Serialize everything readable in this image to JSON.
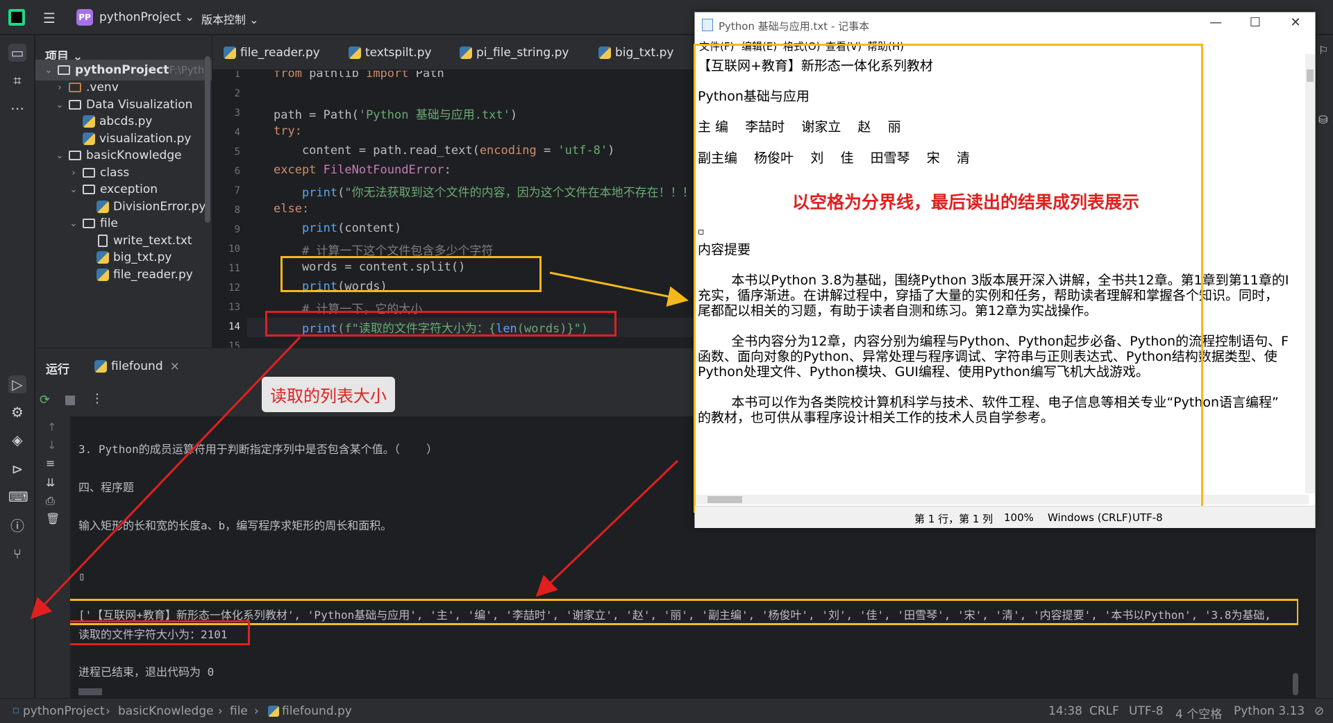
{
  "titlebar": {
    "project_badge": "PP",
    "project": "pythonProject ⌄",
    "vcs": "版本控制 ⌄"
  },
  "project_panel": {
    "header": "项目 ⌄",
    "tree": [
      {
        "label": "pythonProject",
        "extra": " F:\\Pytho",
        "type": "folder",
        "open": true
      },
      {
        "label": ".venv",
        "type": "folder",
        "open": false
      },
      {
        "label": "Data Visualization",
        "type": "folder",
        "open": true
      },
      {
        "label": "abcds.py",
        "type": "py"
      },
      {
        "label": "visualization.py",
        "type": "py"
      },
      {
        "label": "basicKnowledge",
        "type": "folder",
        "open": true
      },
      {
        "label": "class",
        "type": "folder",
        "open": false
      },
      {
        "label": "exception",
        "type": "folder",
        "open": true
      },
      {
        "label": "DivisionError.py",
        "type": "py"
      },
      {
        "label": "file",
        "type": "folder",
        "open": true
      },
      {
        "label": "write_text.txt",
        "type": "txt"
      },
      {
        "label": "big_txt.py",
        "type": "py"
      },
      {
        "label": "file_reader.py",
        "type": "py"
      }
    ]
  },
  "tabs": [
    "file_reader.py",
    "textspilt.py",
    "pi_file_string.py",
    "big_txt.py"
  ],
  "editor": {
    "line_numbers": [
      "1",
      "2",
      "3",
      "4",
      "5",
      "6",
      "7",
      "8",
      "9",
      "10",
      "11",
      "12",
      "13",
      "14",
      "15"
    ],
    "l1_a": "from",
    "l1_b": " pathlib ",
    "l1_c": "import",
    "l1_d": " Path",
    "l3_a": "path = Path(",
    "l3_b": "'Python 基础与应用.txt'",
    "l3_c": ")",
    "l4": "try:",
    "l5_a": "    content = path.read_text(",
    "l5_b": "encoding",
    "l5_c": " = ",
    "l5_d": "'utf-8'",
    "l5_e": ")",
    "l6_a": "except",
    "l6_b": " FileNotFoundError",
    "l6_c": ":",
    "l7_a": "    print",
    "l7_b": "(",
    "l7_c": "\"你无法获取到这个文件的内容，因为这个文件在本地不存在！！！\"",
    "l8": "else:",
    "l9_a": "    print",
    "l9_b": "(content)",
    "l10": "    # 计算一下这个文件包含多少个字符",
    "l11": "    words = content.split()",
    "l12_a": "    print",
    "l12_b": "(words)",
    "l13": "    # 计算一下，它的大小",
    "l14_a": "    print",
    "l14_b": "(f\"读取的文件字符大小为：{",
    "l14_c": "len",
    "l14_d": "(words)}\")"
  },
  "run": {
    "tab_label": "运行",
    "run_tab": "filefound",
    "lines": [
      "3. Python的成员运算符用于判断指定序列中是否包含某个值。（    ）",
      "四、程序题",
      "输入矩形的长和宽的长度a、b，编写程序求矩形的周长和面积。",
      "▯",
      "['【互联网+教育】新形态一体化系列教材', 'Python基础与应用', '主', '编', '李喆时', '谢家立', '赵', '丽', '副主编', '杨俊叶', '刘', '佳', '田雪琴', '宋', '清', '内容提要', '本书以Python', '3.8为基础,",
      "读取的文件字符大小为：2101",
      "进程已结束，退出代码为 0"
    ]
  },
  "status": {
    "breadcrumb": [
      "pythonProject",
      "basicKnowledge",
      "file",
      "filefound.py"
    ],
    "pos": "14:38",
    "eol": "CRLF",
    "enc": "UTF-8",
    "indent": "4 个空格",
    "interp": "Python 3.13"
  },
  "notepad": {
    "title": "Python 基础与应用.txt - 记事本",
    "menu": [
      "文件(F)",
      "编辑(E)",
      "格式(O)",
      "查看(V)",
      "帮助(H)"
    ],
    "lines": [
      "【互联网+教育】新形态一体化系列教材",
      "Python基础与应用",
      "主 编    李喆时    谢家立    赵    丽",
      "副主编    杨俊叶    刘    佳    田雪琴    宋    清",
      "▫",
      "内容提要",
      "        本书以Python 3.8为基础，围绕Python 3版本展开深入讲解，全书共12章。第1章到第11章的I",
      "充实，循序渐进。在讲解过程中，穿插了大量的实例和任务，帮助读者理解和掌握各个知识。同时，",
      "尾都配以相关的习题，有助于读者自测和练习。第12章为实战操作。",
      "        全书内容分为12章，内容分别为编程与Python、Python起步必备、Python的流程控制语句、F",
      "函数、面向对象的Python、异常处理与程序调试、字符串与正则表达式、Python结构数据类型、使",
      "Python处理文件、Python模块、GUI编程、使用Python编写飞机大战游戏。",
      "        本书可以作为各类院校计算机科学与技术、软件工程、电子信息等相关专业“Python语言编程”",
      "的教材，也可供从事程序设计相关工作的技术人员自学参考。"
    ],
    "status": {
      "pos": "第 1 行，第 1 列",
      "zoom": "100%",
      "eol": "Windows (CRLF)",
      "enc": "UTF-8"
    }
  },
  "annotations": {
    "callout": "读取的列表大小",
    "red_note": "以空格为分界线，最后读出的结果成列表展示"
  },
  "colors": {
    "yellow": "#f5b91b",
    "red": "#e0201f"
  }
}
